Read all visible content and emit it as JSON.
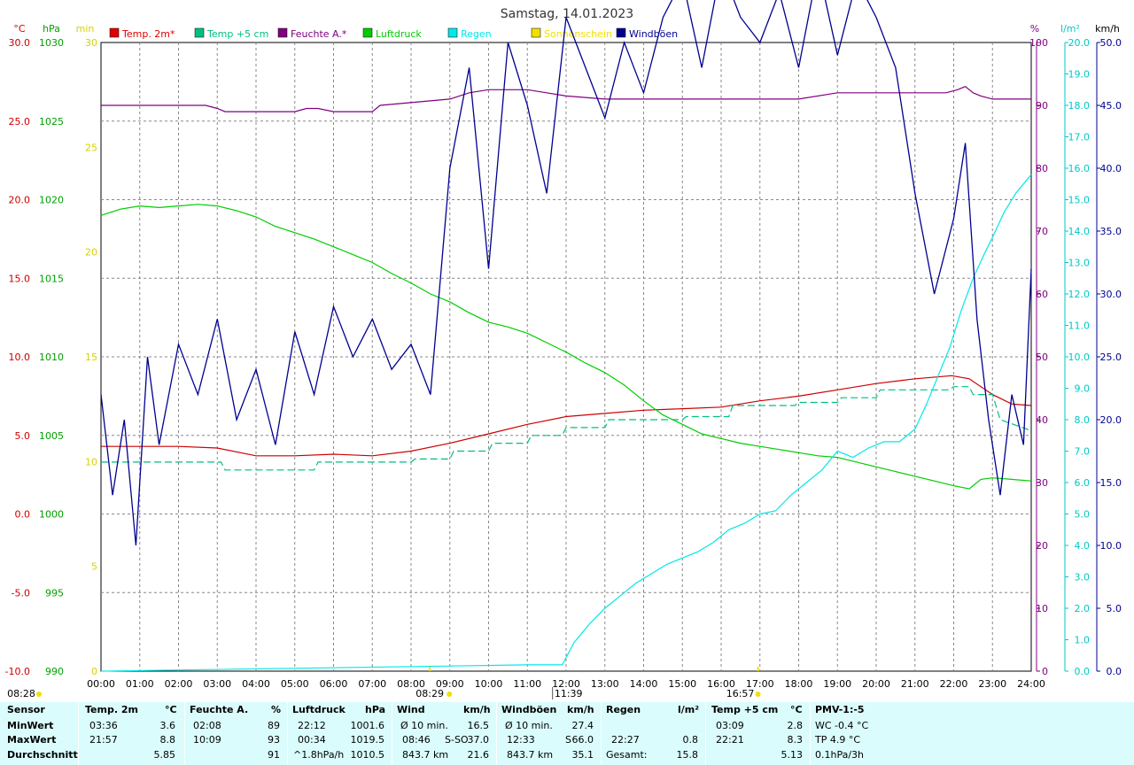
{
  "chart_data": {
    "type": "line",
    "title": "Samstag, 14.01.2023",
    "x_ticks": [
      "00:00",
      "01:00",
      "02:00",
      "03:00",
      "04:00",
      "05:00",
      "06:00",
      "07:00",
      "08:00",
      "09:00",
      "10:00",
      "11:00",
      "12:00",
      "13:00",
      "14:00",
      "15:00",
      "16:00",
      "17:00",
      "18:00",
      "19:00",
      "20:00",
      "21:00",
      "22:00",
      "23:00",
      "24:00"
    ],
    "axes": {
      "temp": {
        "unit": "°C",
        "range": [
          -10,
          30
        ],
        "ticks": [
          "30.0",
          "25.0",
          "20.0",
          "15.0",
          "10.0",
          "5.0",
          "0.0",
          "-5.0",
          "-10.0"
        ]
      },
      "pressure": {
        "unit": "hPa",
        "range": [
          990,
          1030
        ],
        "ticks": [
          "1030",
          "1025",
          "1020",
          "1015",
          "1010",
          "1005",
          "1000",
          "995",
          "990"
        ]
      },
      "sunshine": {
        "unit": "min",
        "range": [
          0,
          30
        ],
        "ticks": [
          "30",
          "25",
          "20",
          "15",
          "10",
          "5",
          "0"
        ]
      },
      "humidity": {
        "unit": "%",
        "range": [
          0,
          100
        ],
        "ticks": [
          "100",
          "90",
          "80",
          "70",
          "60",
          "50",
          "40",
          "30",
          "20",
          "10",
          "0"
        ]
      },
      "rain": {
        "unit": "l/m²",
        "range": [
          0,
          20
        ],
        "ticks": [
          "20.0",
          "19.0",
          "18.0",
          "17.0",
          "16.0",
          "15.0",
          "14.0",
          "13.0",
          "12.0",
          "11.0",
          "10.0",
          "9.0",
          "8.0",
          "7.0",
          "6.0",
          "5.0",
          "4.0",
          "3.0",
          "2.0",
          "1.0",
          "0.0"
        ]
      },
      "wind": {
        "unit": "km/h",
        "range": [
          0,
          50
        ],
        "ticks": [
          "50.0",
          "45.0",
          "40.0",
          "35.0",
          "30.0",
          "25.0",
          "20.0",
          "15.0",
          "10.0",
          "5.0",
          "0.0"
        ]
      }
    },
    "legend": [
      {
        "name": "Temp. 2m*",
        "color": "#e00000"
      },
      {
        "name": "Temp +5 cm",
        "color": "#00c080"
      },
      {
        "name": "Feuchte A.*",
        "color": "#800080"
      },
      {
        "name": "Luftdruck",
        "color": "#00cc00"
      },
      {
        "name": "Regen",
        "color": "#00e8e8"
      },
      {
        "name": "Sonnenschein",
        "color": "#f0e000"
      },
      {
        "name": "Windböen",
        "color": "#000090"
      }
    ],
    "series": [
      {
        "name": "Temp. 2m*",
        "axis": "temp",
        "color": "#cc0000",
        "x": [
          0,
          2,
          3,
          4,
          5,
          6,
          7,
          8,
          9,
          10,
          11,
          12,
          13,
          14,
          15,
          16,
          17,
          18,
          19,
          20,
          21,
          21.95,
          22.4,
          23,
          23.5,
          24
        ],
        "values": [
          4.3,
          4.3,
          4.2,
          3.7,
          3.7,
          3.8,
          3.7,
          4.0,
          4.5,
          5.1,
          5.7,
          6.2,
          6.4,
          6.6,
          6.7,
          6.8,
          7.2,
          7.5,
          7.9,
          8.3,
          8.6,
          8.8,
          8.6,
          7.6,
          7.0,
          6.9
        ]
      },
      {
        "name": "Temp +5 cm",
        "axis": "temp",
        "color": "#00c080",
        "x": [
          0,
          3.1,
          3.2,
          5.5,
          5.6,
          8.0,
          8.1,
          9.0,
          9.1,
          10.0,
          10.1,
          11.0,
          11.1,
          11.9,
          12.0,
          13.0,
          13.1,
          15.0,
          15.1,
          16.2,
          16.3,
          17.9,
          18.0,
          19.0,
          19.1,
          20.0,
          20.1,
          21.9,
          22.0,
          22.4,
          22.5,
          23.0,
          23.2,
          24
        ],
        "values": [
          3.3,
          3.3,
          2.8,
          2.8,
          3.3,
          3.3,
          3.5,
          3.5,
          4.0,
          4.0,
          4.5,
          4.5,
          5.0,
          5.0,
          5.5,
          5.5,
          6.0,
          6.0,
          6.2,
          6.2,
          6.9,
          6.9,
          7.1,
          7.1,
          7.4,
          7.4,
          7.9,
          7.9,
          8.1,
          8.1,
          7.6,
          7.6,
          6.0,
          5.3
        ]
      },
      {
        "name": "Feuchte A.*",
        "axis": "humidity",
        "color": "#800080",
        "x": [
          0,
          2.7,
          3.0,
          3.2,
          4.0,
          5.0,
          5.3,
          5.6,
          6.0,
          6.5,
          7.0,
          7.2,
          9.0,
          9.5,
          10.0,
          10.3,
          11.0,
          11.5,
          12.0,
          13.0,
          14.0,
          15.0,
          16.0,
          17.0,
          18.0,
          19.0,
          20.0,
          21.0,
          21.8,
          22.1,
          22.3,
          22.5,
          22.7,
          23.0,
          23.5,
          24
        ],
        "values": [
          90,
          90,
          89.5,
          89,
          89,
          89,
          89.5,
          89.5,
          89,
          89,
          89,
          90,
          91,
          92,
          92.5,
          92.5,
          92.5,
          92,
          91.5,
          91,
          91,
          91,
          91,
          91,
          91,
          92,
          92,
          92,
          92,
          92.5,
          93,
          92,
          91.5,
          91,
          91,
          91
        ]
      },
      {
        "name": "Luftdruck",
        "axis": "pressure",
        "color": "#00cc00",
        "x": [
          0,
          0.5,
          1,
          1.5,
          2,
          2.5,
          3,
          3.5,
          4,
          4.5,
          5,
          5.5,
          6,
          6.5,
          7,
          7.5,
          8,
          8.5,
          9,
          9.5,
          10,
          10.5,
          11,
          11.5,
          12,
          12.5,
          13,
          13.5,
          14,
          14.5,
          15,
          15.5,
          16,
          16.5,
          17,
          17.5,
          18,
          18.5,
          19,
          19.5,
          20,
          20.5,
          21,
          21.5,
          22,
          22.4,
          22.7,
          23,
          23.5,
          24
        ],
        "values": [
          1019.0,
          1019.4,
          1019.6,
          1019.5,
          1019.6,
          1019.7,
          1019.6,
          1019.3,
          1018.9,
          1018.3,
          1017.9,
          1017.5,
          1017.0,
          1016.5,
          1016.0,
          1015.3,
          1014.7,
          1014.0,
          1013.5,
          1012.8,
          1012.2,
          1011.9,
          1011.5,
          1010.9,
          1010.3,
          1009.6,
          1009.0,
          1008.2,
          1007.2,
          1006.3,
          1005.7,
          1005.1,
          1004.8,
          1004.5,
          1004.3,
          1004.1,
          1003.9,
          1003.7,
          1003.6,
          1003.3,
          1003.0,
          1002.7,
          1002.4,
          1002.1,
          1001.8,
          1001.6,
          1002.2,
          1002.3,
          1002.2,
          1002.1
        ]
      },
      {
        "name": "Regen",
        "axis": "rain",
        "color": "#00e8e8",
        "x": [
          0,
          11.0,
          11.9,
          12.2,
          12.6,
          13.0,
          13.4,
          13.8,
          14.2,
          14.6,
          15.0,
          15.4,
          15.8,
          16.2,
          16.6,
          17.0,
          17.4,
          17.8,
          18.2,
          18.6,
          19.0,
          19.4,
          19.8,
          20.2,
          20.6,
          21.0,
          21.3,
          21.6,
          21.9,
          22.2,
          22.5,
          22.8,
          23.0,
          23.3,
          23.6,
          24
        ],
        "values": [
          0,
          0.2,
          0.2,
          0.9,
          1.5,
          2.0,
          2.4,
          2.8,
          3.1,
          3.4,
          3.6,
          3.8,
          4.1,
          4.5,
          4.7,
          5.0,
          5.1,
          5.6,
          6.0,
          6.4,
          7.0,
          6.8,
          7.1,
          7.3,
          7.3,
          7.7,
          8.5,
          9.4,
          10.3,
          11.5,
          12.5,
          13.3,
          13.8,
          14.6,
          15.2,
          15.8
        ]
      },
      {
        "name": "Windböen",
        "axis": "wind",
        "color": "#000090",
        "x": [
          0,
          0.3,
          0.6,
          0.9,
          1.2,
          1.5,
          2,
          2.5,
          3,
          3.5,
          4,
          4.5,
          5,
          5.5,
          6,
          6.5,
          7,
          7.5,
          8,
          8.5,
          9,
          9.5,
          10,
          10.5,
          11,
          11.5,
          12,
          12.5,
          13,
          13.5,
          14,
          14.5,
          15,
          15.5,
          16,
          16.5,
          17,
          17.5,
          18,
          18.5,
          19,
          19.5,
          20,
          20.5,
          21,
          21.5,
          22,
          22.3,
          22.6,
          22.9,
          23.2,
          23.5,
          23.8,
          24
        ],
        "values": [
          22,
          14,
          20,
          10,
          25,
          18,
          26,
          22,
          28,
          20,
          24,
          18,
          27,
          22,
          29,
          25,
          28,
          24,
          26,
          22,
          40,
          48,
          32,
          50,
          45,
          38,
          52,
          48,
          44,
          50,
          46,
          52,
          55,
          48,
          56,
          52,
          50,
          54,
          48,
          56,
          49,
          55,
          52,
          48,
          38,
          30,
          36,
          42,
          28,
          20,
          14,
          22,
          18,
          32
        ]
      }
    ]
  },
  "annotations": {
    "sunrise": "08:29",
    "sunset": "16:57",
    "noon": "11:39",
    "left_marker": "08:28"
  },
  "stats": {
    "row_labels": [
      "Sensor",
      "MinWert",
      "MaxWert",
      "Durchschnitt"
    ],
    "temp2m": {
      "title": "Temp. 2m",
      "unit": "°C",
      "min_time": "03:36",
      "min": "3.6",
      "max_time": "21:57",
      "max": "8.8",
      "avg": "5.85"
    },
    "humidity": {
      "title": "Feuchte A.",
      "unit": "%",
      "min_time": "02:08",
      "min": "89",
      "max_time": "10:09",
      "max": "93",
      "avg": "91"
    },
    "pressure": {
      "title": "Luftdruck",
      "unit": "hPa",
      "min_time": "22:12",
      "min": "1001.6",
      "max_time": "00:34",
      "max": "1019.5",
      "avg_note": "^1.8hPa/h",
      "avg": "1010.5"
    },
    "wind": {
      "title": "Wind",
      "unit": "km/h",
      "min_label": "Ø 10 min.",
      "min": "16.5",
      "max_time": "08:46",
      "max_dir": "S-SO",
      "max": "37.0",
      "avg_dist": "843.7 km",
      "avg": "21.6"
    },
    "gusts": {
      "title": "Windböen",
      "unit": "km/h",
      "min_label": "Ø 10 min.",
      "min": "27.4",
      "max_time": "12:33",
      "max_dir": "S",
      "max": "66.0",
      "avg_dist": "843.7 km",
      "avg": "35.1"
    },
    "rain": {
      "title": "Regen",
      "unit": "l/m²",
      "max_time": "22:27",
      "max": "0.8",
      "total_label": "Gesamt:",
      "total": "15.8"
    },
    "temp5cm": {
      "title": "Temp +5 cm",
      "unit": "°C",
      "min_time": "03:09",
      "min": "2.8",
      "max_time": "22:21",
      "max": "8.3",
      "avg": "5.13"
    },
    "pmv": {
      "title": "PMV-1:-5",
      "wc": "WC -0.4 °C",
      "tp": "TP 4.9 °C",
      "trend": "0.1hPa/3h"
    }
  }
}
